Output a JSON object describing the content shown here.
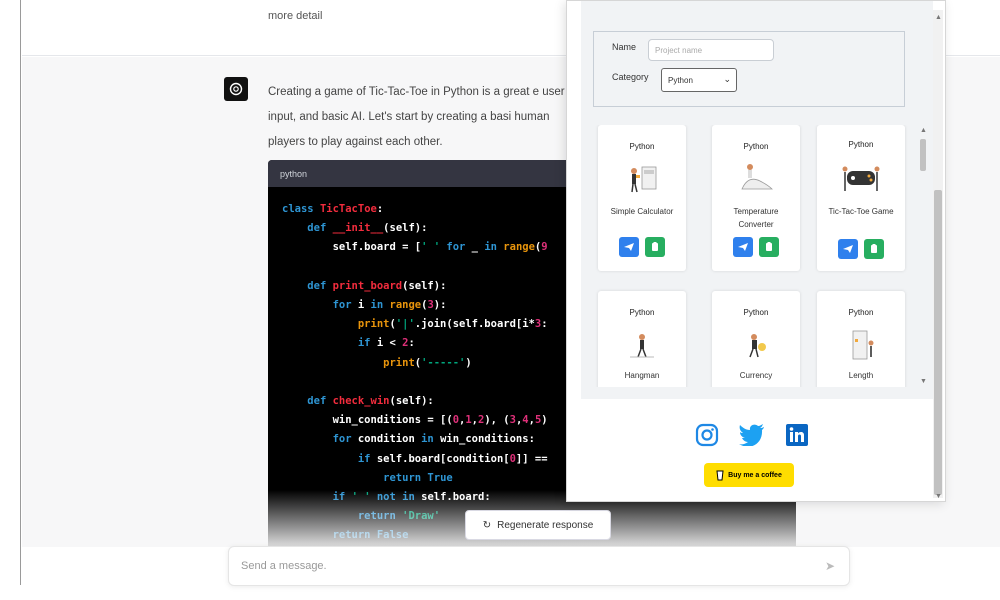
{
  "chat": {
    "top_fragment": "more detail",
    "message": "Creating a game of Tic-Tac-Toe in Python is a great e user input, and basic AI. Let's start by creating a basi human players to play against each other.",
    "code_language": "python",
    "regenerate_label": "Regenerate response",
    "composer_placeholder": "Send a message."
  },
  "extension": {
    "form": {
      "name_label": "Name",
      "name_placeholder": "Project name",
      "category_label": "Category",
      "category_value": "Python"
    },
    "cards": [
      {
        "category": "Python",
        "title": "Simple Calculator"
      },
      {
        "category": "Python",
        "title": "Temperature Converter"
      },
      {
        "category": "Python",
        "title": "Tic-Tac-Toe Game"
      },
      {
        "category": "Python",
        "title": "Hangman"
      },
      {
        "category": "Python",
        "title": "Currency"
      },
      {
        "category": "Python",
        "title": "Length"
      }
    ],
    "socials": [
      "instagram-icon",
      "twitter-icon",
      "linkedin-icon"
    ],
    "coffee_label": "Buy me a coffee"
  },
  "colors": {
    "accent_blue": "#2f80ed",
    "accent_green": "#27ae60",
    "coffee_yellow": "#ffdd00",
    "twitter": "#1da1f2",
    "linkedin": "#0a66c2"
  }
}
